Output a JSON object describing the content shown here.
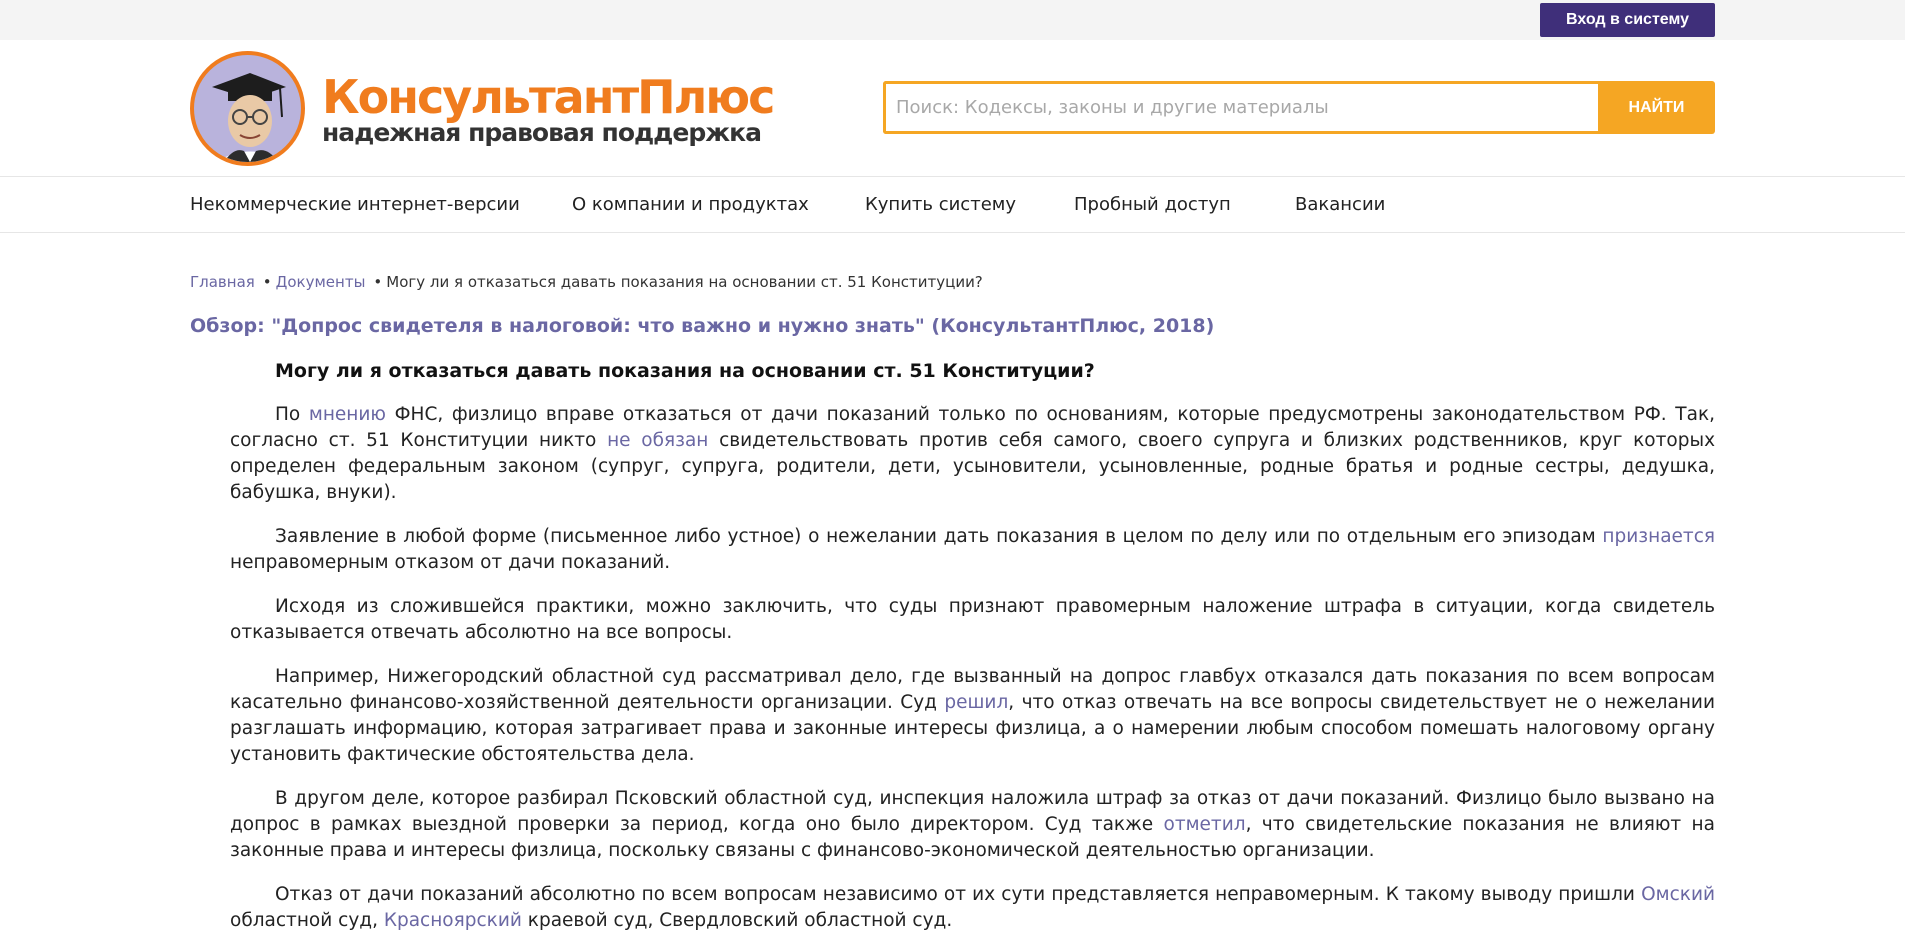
{
  "topbar": {
    "login_label": "Вход в систему"
  },
  "header": {
    "logo_word": "КонсультантПлюс",
    "logo_subtitle": "надежная правовая поддержка",
    "search_placeholder": "Поиск: Кодексы, законы и другие материалы",
    "search_button": "НАЙТИ"
  },
  "nav": [
    {
      "label": "Некоммерческие интернет-версии"
    },
    {
      "label": "О компании и продуктах"
    },
    {
      "label": "Купить систему"
    },
    {
      "label": "Пробный доступ"
    },
    {
      "label": "Вакансии"
    }
  ],
  "breadcrumb": {
    "home": "Главная",
    "sep": "•",
    "documents": "Документы",
    "current": "Могу ли я отказаться давать показания на основании ст. 51 Конституции?"
  },
  "review_title": "Обзор: \"Допрос свидетеля в налоговой: что важно и нужно знать\" (КонсультантПлюс, 2018)",
  "article": {
    "question": "Могу ли я отказаться давать показания на основании ст. 51 Конституции?",
    "p1": {
      "t1": "По ",
      "link1": "мнению",
      "t2": " ФНС, физлицо вправе отказаться от дачи показаний только по основаниям, которые предусмотрены законодательством РФ. Так, согласно ст. 51 Конституции никто ",
      "link2": "не обязан",
      "t3": " свидетельствовать против себя самого, своего супруга и близких родственников, круг которых определен федеральным законом (супруг, супруга, родители, дети, усыновители, усыновленные, родные братья и родные сестры, дедушка, бабушка, внуки)."
    },
    "p2": {
      "t1": "Заявление в любой форме (письменное либо устное) о нежелании дать показания в целом по делу или по отдельным его эпизодам ",
      "link1": "признается",
      "t2": " неправомерным отказом от дачи показаний."
    },
    "p3": {
      "t1": "Исходя из сложившейся практики, можно заключить, что суды признают правомерным наложение штрафа в ситуации, когда свидетель отказывается отвечать абсолютно на все вопросы."
    },
    "p4": {
      "t1": "Например, Нижегородский областной суд рассматривал дело, где вызванный на допрос главбух отказался дать показания по всем вопросам касательно финансово-хозяйственной деятельности организации. Суд ",
      "link1": "решил",
      "t2": ", что отказ отвечать на все вопросы свидетельствует не о нежелании разглашать информацию, которая затрагивает права и законные интересы физлица, а о намерении любым способом помешать налоговому органу установить фактические обстоятельства дела."
    },
    "p5": {
      "t1": "В другом деле, которое разбирал Псковский областной суд, инспекция наложила штраф за отказ от дачи показаний. Физлицо было вызвано на допрос в рамках выездной проверки за период, когда оно было директором. Суд также ",
      "link1": "отметил",
      "t2": ", что свидетельские показания не влияют на законные права и интересы физлица, поскольку связаны с финансово-экономической деятельностью организации."
    },
    "p6": {
      "t1": "Отказ от дачи показаний абсолютно по всем вопросам независимо от их сути представляется неправомерным. К такому выводу пришли ",
      "link1": "Омский",
      "t2": " областной суд, ",
      "link2": "Красноярский",
      "t3": " краевой суд, Свердловский областной суд."
    }
  },
  "colors": {
    "brand_orange": "#f07c1e",
    "search_accent": "#f5a623",
    "login_purple": "#3f2f7a",
    "link_purple": "#6a67a3"
  }
}
